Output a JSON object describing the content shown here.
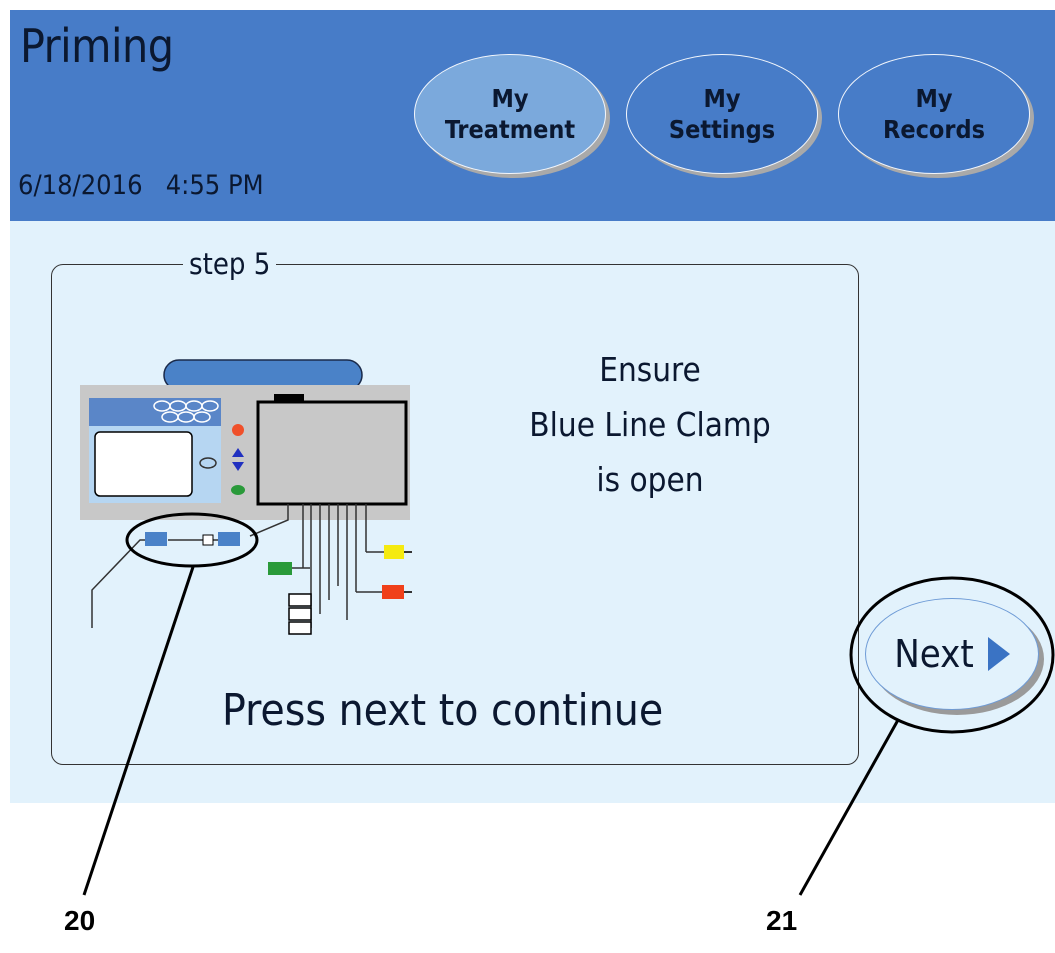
{
  "header": {
    "title": "Priming",
    "date": "6/18/2016",
    "time": "4:55 PM",
    "nav": [
      {
        "line1": "My",
        "line2": "Treatment",
        "active": true
      },
      {
        "line1": "My",
        "line2": "Settings",
        "active": false
      },
      {
        "line1": "My",
        "line2": "Records",
        "active": false
      }
    ]
  },
  "step": {
    "label": "step 5",
    "instruction": [
      "Ensure",
      "Blue Line Clamp",
      "is open"
    ],
    "continue_text": "Press next to continue"
  },
  "next_button": {
    "label": "Next"
  },
  "callouts": [
    "20",
    "21"
  ],
  "colors": {
    "header_bg": "#477cc8",
    "content_bg": "#e2f2fc",
    "active_tab": "#7ba9dc",
    "clamp_blue": "#4a82c8"
  }
}
